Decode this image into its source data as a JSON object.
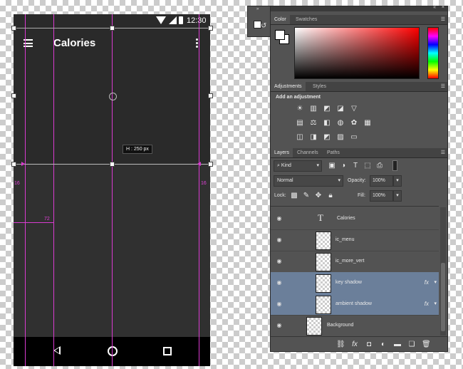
{
  "phone": {
    "status": {
      "time": "12:30"
    },
    "toolbar": {
      "title": "Calories"
    },
    "height_tooltip": {
      "prefix": "H :",
      "value": "250 px"
    },
    "measures": {
      "left": "16",
      "right": "16",
      "keyline": "72"
    }
  },
  "ps": {
    "color_tabs": [
      "Color",
      "Swatches"
    ],
    "adjust_tabs": [
      "Adjustments",
      "Styles"
    ],
    "adjust_heading": "Add an adjustment",
    "layers_tabs": [
      "Layers",
      "Channels",
      "Paths"
    ],
    "filter_kind": "Kind",
    "blend_mode": "Normal",
    "opacity_label": "Opacity:",
    "opacity_value": "100%",
    "lock_label": "Lock:",
    "fill_label": "Fill:",
    "fill_value": "100%",
    "layers": [
      {
        "name": "Calories",
        "type": "text"
      },
      {
        "name": "ic_menu",
        "type": "smart"
      },
      {
        "name": "ic_more_vert",
        "type": "smart"
      },
      {
        "name": "key shadow",
        "type": "smart",
        "fx": "fx"
      },
      {
        "name": "ambient shadow",
        "type": "smart",
        "fx": "fx"
      },
      {
        "name": "Background",
        "type": "smart"
      }
    ],
    "colors": {
      "selection": "#6b7f9a",
      "guide": "#d93bd0"
    }
  }
}
